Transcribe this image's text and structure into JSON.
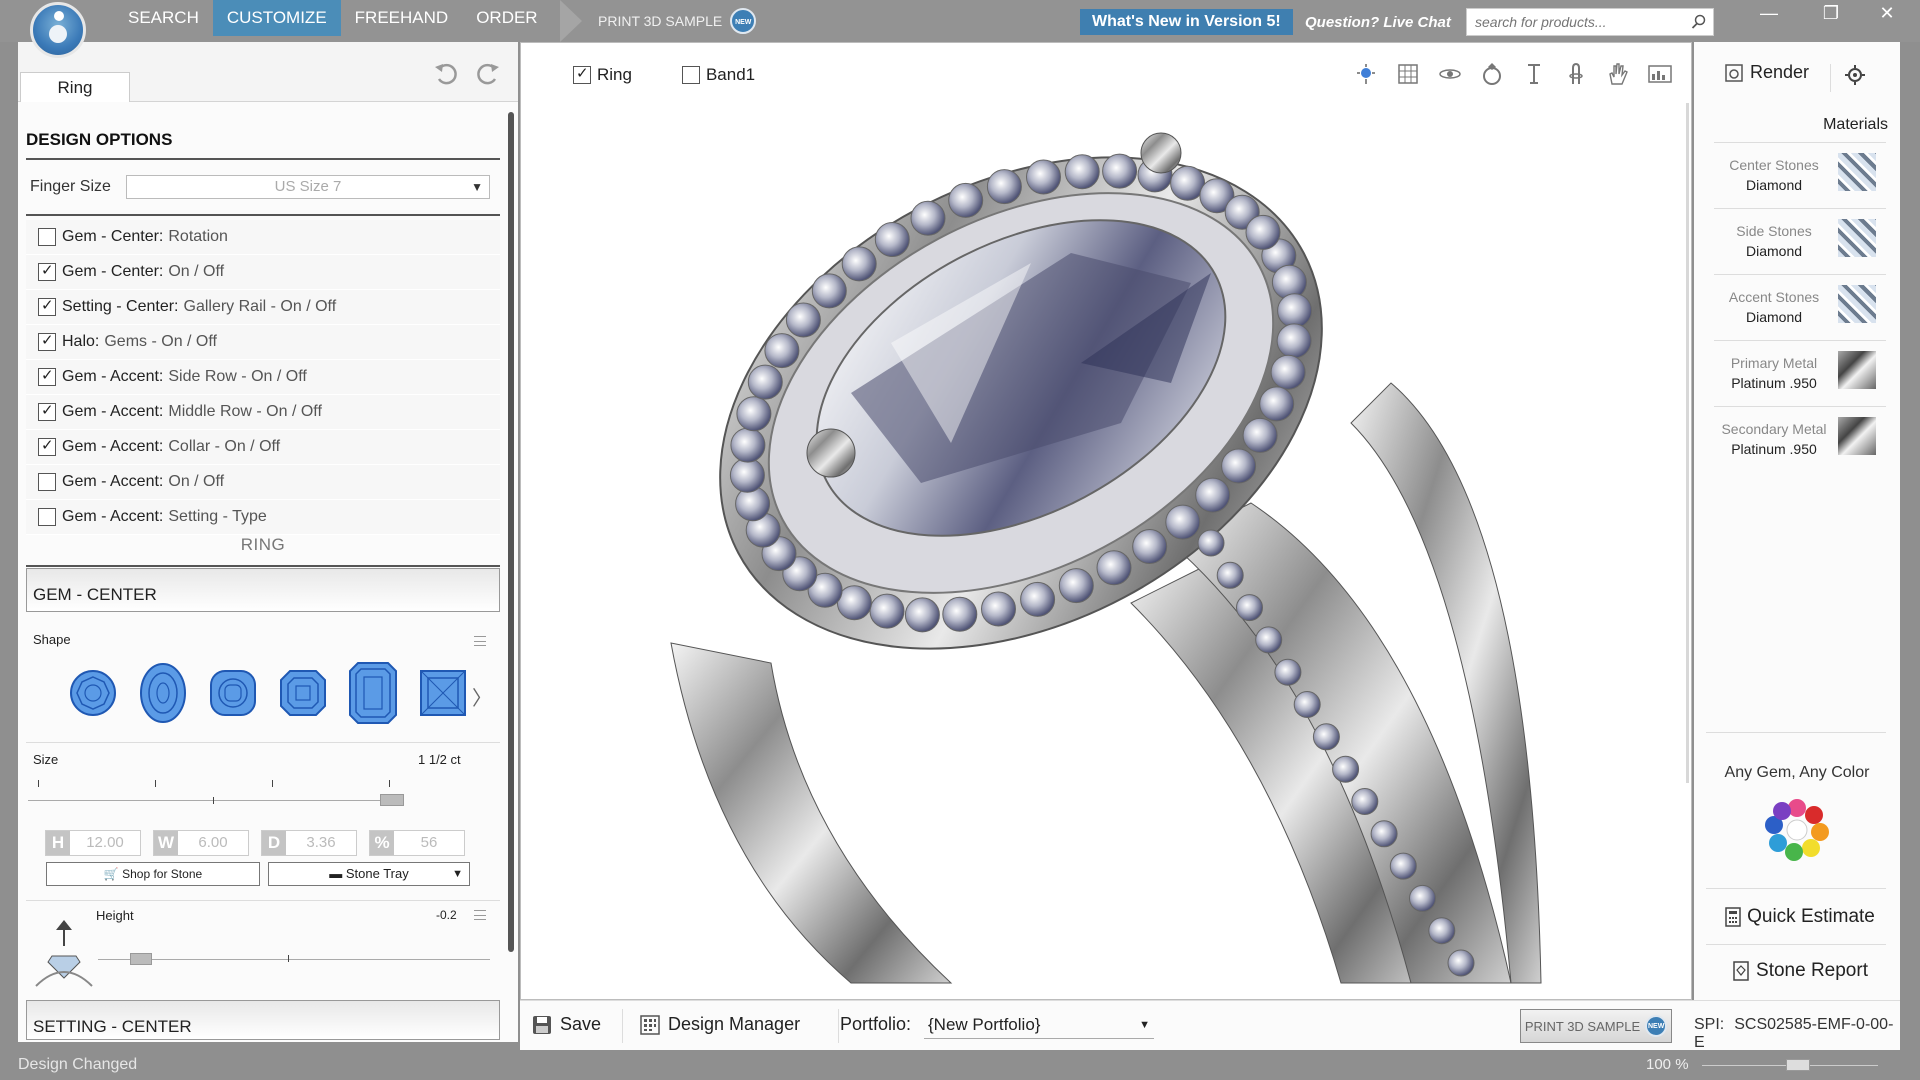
{
  "nav": {
    "items": [
      "SEARCH",
      "CUSTOMIZE",
      "FREEHAND",
      "ORDER"
    ],
    "active_index": 1,
    "print_sample": "PRINT 3D SAMPLE",
    "new_badge": "NEW"
  },
  "header": {
    "whats_new": "What's New in Version 5!",
    "live_chat": "Question? Live Chat",
    "search_placeholder": "search for products..."
  },
  "window_controls": [
    "—",
    "❐",
    "✕"
  ],
  "left": {
    "tab": "Ring",
    "design_options_title": "DESIGN OPTIONS",
    "finger_size_label": "Finger Size",
    "finger_size_value": "US Size 7",
    "options": [
      {
        "key": "Gem - Center:",
        "value": "Rotation",
        "checked": false
      },
      {
        "key": "Gem - Center:",
        "value": "On / Off",
        "checked": true
      },
      {
        "key": "Setting - Center:",
        "value": "Gallery Rail - On / Off",
        "checked": true
      },
      {
        "key": "Halo:",
        "value": "Gems - On / Off",
        "checked": true
      },
      {
        "key": "Gem - Accent:",
        "value": "Side Row - On / Off",
        "checked": true
      },
      {
        "key": "Gem - Accent:",
        "value": "Middle Row - On / Off",
        "checked": true
      },
      {
        "key": "Gem - Accent:",
        "value": "Collar - On / Off",
        "checked": true
      },
      {
        "key": "Gem - Accent:",
        "value": "On / Off",
        "checked": false
      },
      {
        "key": "Gem - Accent:",
        "value": "Setting - Type",
        "checked": false
      }
    ],
    "ring_label": "RING",
    "gem_center_title": "GEM - CENTER",
    "shape_label": "Shape",
    "shapes": [
      "round",
      "oval",
      "cushion",
      "asscher",
      "emerald",
      "princess"
    ],
    "size_label": "Size",
    "size_value": "1 1/2 ct",
    "size_fraction": 1.0,
    "dims": [
      {
        "badge": "H",
        "value": "12.00"
      },
      {
        "badge": "W",
        "value": "6.00"
      },
      {
        "badge": "D",
        "value": "3.36"
      },
      {
        "badge": "%",
        "value": "56"
      }
    ],
    "shop_for_stone": "Shop for Stone",
    "stone_tray": "Stone Tray",
    "height_label": "Height",
    "height_value": "-0.2",
    "setting_center_title": "SETTING - CENTER"
  },
  "viewport": {
    "ring_checkbox": "Ring",
    "ring_checked": true,
    "band_checkbox": "Band1",
    "band_checked": false,
    "tools": [
      "light-icon",
      "grid-icon",
      "orbit-icon",
      "ring-view-icon",
      "measure-icon",
      "finger-icon",
      "hand-icon",
      "image-icon"
    ]
  },
  "right": {
    "render": "Render",
    "materials_title": "Materials",
    "materials": [
      {
        "name": "Center Stones",
        "value": "Diamond",
        "swatch": "diamond"
      },
      {
        "name": "Side Stones",
        "value": "Diamond",
        "swatch": "diamond"
      },
      {
        "name": "Accent Stones",
        "value": "Diamond",
        "swatch": "diamond"
      },
      {
        "name": "Primary Metal",
        "value": "Platinum .950",
        "swatch": "metal"
      },
      {
        "name": "Secondary Metal",
        "value": "Platinum .950",
        "swatch": "metal"
      }
    ],
    "any_gem": "Any Gem, Any Color",
    "quick_estimate": "Quick Estimate",
    "stone_report": "Stone Report"
  },
  "bottom": {
    "save": "Save",
    "design_manager": "Design Manager",
    "portfolio_label": "Portfolio:",
    "portfolio_value": "{New Portfolio}",
    "print_sample": "PRINT 3D SAMPLE",
    "spi_label": "SPI:",
    "spi_value": "SCS02585-EMF-0-00-E"
  },
  "status": {
    "text": "Design Changed",
    "zoom": "100 %"
  },
  "colors": {
    "accent": "#4b8db8",
    "chrome": "#939393",
    "shape_blue": "#3f7fd8"
  }
}
